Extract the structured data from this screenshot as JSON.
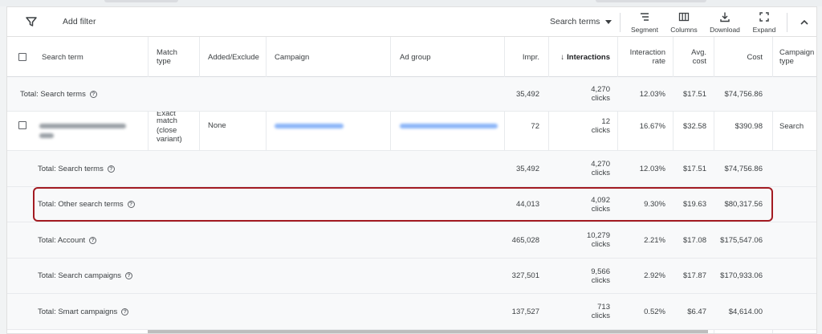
{
  "toolbar": {
    "add_filter": "Add filter",
    "search_terms_dropdown": "Search terms",
    "segment": "Segment",
    "columns": "Columns",
    "download": "Download",
    "expand": "Expand"
  },
  "columns": {
    "search_term": "Search term",
    "match_type_1": "Match",
    "match_type_2": "type",
    "added_excluded": "Added/Exclude",
    "campaign": "Campaign",
    "ad_group": "Ad group",
    "impr": "Impr.",
    "interactions": "Interactions",
    "interactions_sort": "↓",
    "interaction_rate_1": "Interaction",
    "interaction_rate_2": "rate",
    "avg_cost_1": "Avg.",
    "avg_cost_2": "cost",
    "cost": "Cost",
    "campaign_type_1": "Campaign",
    "campaign_type_2": "type"
  },
  "rows": {
    "total_search_terms_top": {
      "label": "Total: Search terms",
      "impr": "35,492",
      "interactions": "4,270",
      "interactions_unit": "clicks",
      "rate": "12.03%",
      "avg_cost": "$17.51",
      "cost": "$74,756.86"
    },
    "search_term_row": {
      "match_line0": "Exact",
      "match_line1": "match",
      "match_line2": "(close",
      "match_line3": "variant)",
      "added_excluded": "None",
      "impr": "72",
      "interactions": "12",
      "interactions_unit": "clicks",
      "rate": "16.67%",
      "avg_cost": "$32.58",
      "cost": "$390.98",
      "campaign_type": "Search"
    },
    "total_search_terms": {
      "label": "Total: Search terms",
      "impr": "35,492",
      "interactions": "4,270",
      "interactions_unit": "clicks",
      "rate": "12.03%",
      "avg_cost": "$17.51",
      "cost": "$74,756.86"
    },
    "total_other_search_terms": {
      "label": "Total: Other search terms",
      "impr": "44,013",
      "interactions": "4,092",
      "interactions_unit": "clicks",
      "rate": "9.30%",
      "avg_cost": "$19.63",
      "cost": "$80,317.56"
    },
    "total_account": {
      "label": "Total: Account",
      "impr": "465,028",
      "interactions": "10,279",
      "interactions_unit": "clicks",
      "rate": "2.21%",
      "avg_cost": "$17.08",
      "cost": "$175,547.06"
    },
    "total_search_campaigns": {
      "label": "Total: Search campaigns",
      "impr": "327,501",
      "interactions": "9,566",
      "interactions_unit": "clicks",
      "rate": "2.92%",
      "avg_cost": "$17.87",
      "cost": "$170,933.06"
    },
    "total_smart_campaigns": {
      "label": "Total: Smart campaigns",
      "impr": "137,527",
      "interactions": "713",
      "interactions_unit": "clicks",
      "rate": "0.52%",
      "avg_cost": "$6.47",
      "cost": "$4,614.00"
    }
  },
  "colors": {
    "highlight_border": "#a31b22",
    "blurred_link": "#8ab4f8",
    "blurred_text": "#9aa0a6"
  },
  "icons": {
    "filter": "filter-icon",
    "dropdown": "caret-down-icon",
    "segment": "segment-icon",
    "columns": "columns-icon",
    "download": "download-icon",
    "expand": "expand-icon",
    "collapse": "chevron-up-icon",
    "help": "help-circle-icon"
  }
}
